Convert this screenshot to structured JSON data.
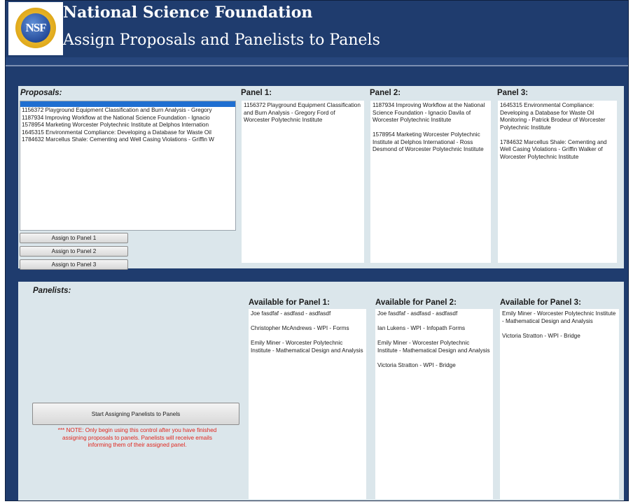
{
  "header": {
    "logo_text": "NSF",
    "title": "National Science Foundation",
    "subtitle": "Assign Proposals and Panelists to Panels"
  },
  "proposals": {
    "heading": "Proposals:",
    "items": [
      "1156372 Playground Equipment Classification and Burn Analysis - Gregory",
      "1187934 Improving Workflow at the National Science Foundation - Ignacio",
      "1578954 Marketing Worcester Polytechnic Institute at Delphos Internation",
      "1645315 Environmental Compliance: Developing a Database for Waste Oil",
      "1784632 Marcellus Shale: Cementing and Well Casing Violations - Griffin W"
    ],
    "assign_buttons": [
      "Assign to Panel 1",
      "Assign to Panel 2",
      "Assign to Panel 3"
    ]
  },
  "panels": [
    {
      "heading": "Panel 1:",
      "items": [
        "1156372 Playground Equipment Classification and Burn Analysis - Gregory Ford of Worcester Polytechnic Institute"
      ]
    },
    {
      "heading": "Panel 2:",
      "items": [
        "1187934 Improving Workflow at the National Science Foundation - Ignacio Davila of Worcester Polytechnic Institute",
        "1578954 Marketing Worcester Polytechnic Institute at Delphos International - Ross Desmond of Worcester Polytechnic Institute"
      ]
    },
    {
      "heading": "Panel 3:",
      "items": [
        "1645315 Environmental Compliance: Developing a Database for Waste Oil Monitoring - Patrick Brodeur of Worcester Polytechnic Institute",
        "1784632 Marcellus Shale: Cementing and Well Casing Violations - Griffin Walker of Worcester Polytechnic Institute"
      ]
    }
  ],
  "panelists": {
    "heading": "Panelists:",
    "start_button": "Start Assigning Panelists to Panels",
    "note": "*** NOTE: Only begin using this control after you have finished assigning proposals to panels.  Panelists will receive emails informing them of their assigned panel."
  },
  "available": [
    {
      "heading": "Available for Panel 1:",
      "items": [
        "Joe fasdfaf - asdfasd - asdfasdf",
        "Christopher McAndrews - WPI - Forms",
        "Emily Miner - Worcester Polytechnic Institute - Mathematical Design and Analysis"
      ]
    },
    {
      "heading": "Available for Panel 2:",
      "items": [
        "Joe fasdfaf - asdfasd - asdfasdf",
        "Ian Lukens - WPI - Infopath Forms",
        "Emily Miner - Worcester Polytechnic Institute - Mathematical Design and Analysis",
        "Victoria Stratton - WPI - Bridge"
      ]
    },
    {
      "heading": "Available for Panel 3:",
      "items": [
        "Emily Miner - Worcester Polytechnic Institute - Mathematical Design and Analysis",
        "Victoria Stratton - WPI - Bridge"
      ]
    }
  ],
  "colors": {
    "header_bg": "#1f3c6e",
    "section_bg": "#dbe6eb",
    "selection": "#1f6fd1",
    "note_text": "#e0261d"
  }
}
